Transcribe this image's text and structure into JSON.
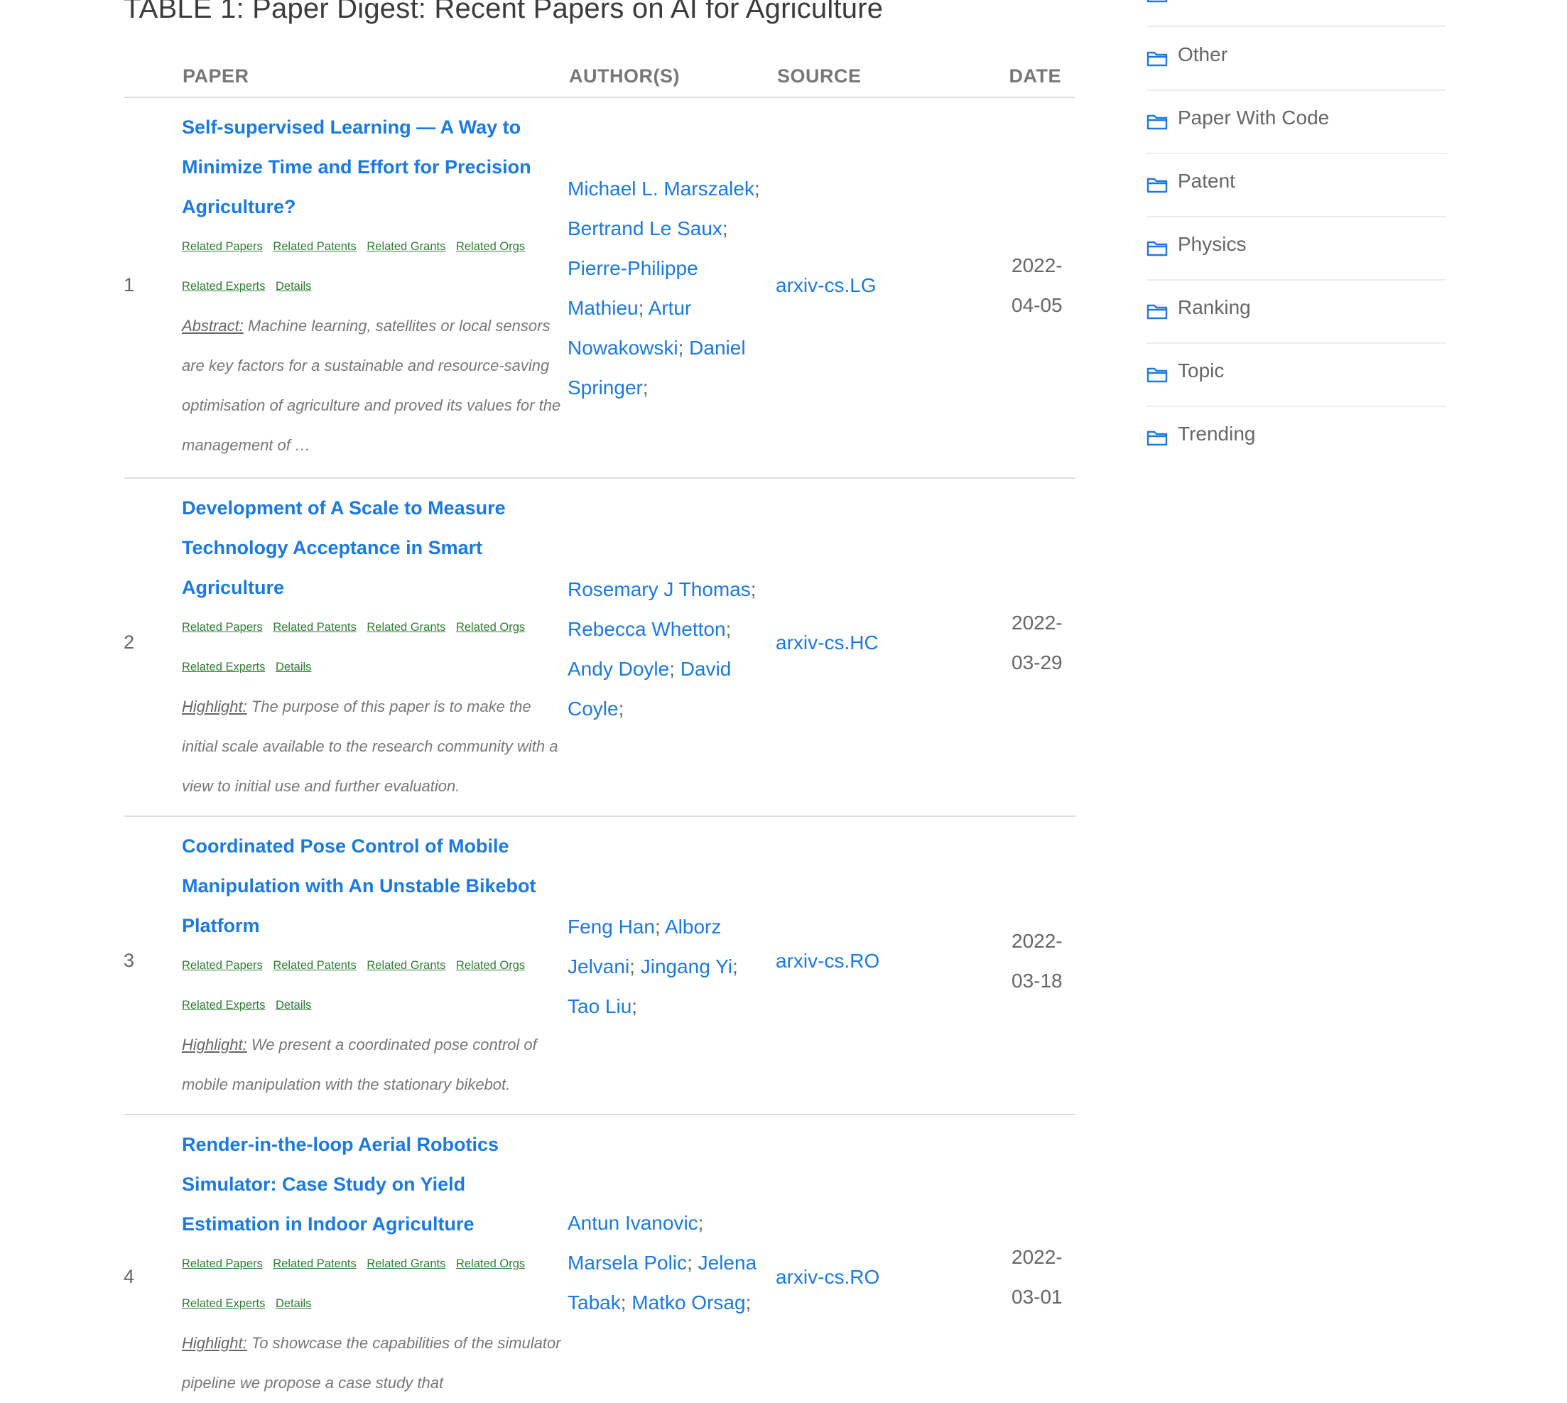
{
  "table": {
    "title": "TABLE 1: Paper Digest: Recent Papers on AI for Agriculture",
    "headers": {
      "paper": "PAPER",
      "authors": "AUTHOR(S)",
      "source": "SOURCE",
      "date": "DATE"
    },
    "link_labels": [
      "Related Papers",
      "Related Patents",
      "Related Grants",
      "Related Orgs",
      "Related Experts",
      "Details"
    ],
    "rows": [
      {
        "num": "1",
        "title": "Self-supervised Learning — A Way to Minimize Time and Effort for Precision Agriculture?",
        "summary_label": "Abstract:",
        "summary": " Machine learning, satellites or local sensors are key factors for a sustainable and resource-saving optimisation of agriculture and proved its values for the management of …",
        "authors": [
          "Michael L. Marszalek",
          "Bertrand Le Saux",
          "Pierre-Philippe Mathieu",
          "Artur Nowakowski",
          "Daniel Springer"
        ],
        "source": "arxiv-cs.LG",
        "date": "2022-04-05"
      },
      {
        "num": "2",
        "title": "Development of A Scale to Measure Technology Acceptance in Smart Agriculture",
        "summary_label": "Highlight:",
        "summary": " The purpose of this paper is to make the initial scale available to the research community with a view to initial use and further evaluation.",
        "authors": [
          "Rosemary J Thomas",
          "Rebecca Whetton",
          "Andy Doyle",
          "David Coyle"
        ],
        "source": "arxiv-cs.HC",
        "date": "2022-03-29"
      },
      {
        "num": "3",
        "title": "Coordinated Pose Control of Mobile Manipulation with An Unstable Bikebot Platform",
        "summary_label": "Highlight:",
        "summary": " We present a coordinated pose control of mobile manipulation with the stationary bikebot.",
        "authors": [
          "Feng Han",
          "Alborz Jelvani",
          "Jingang Yi",
          "Tao Liu"
        ],
        "source": "arxiv-cs.RO",
        "date": "2022-03-18"
      },
      {
        "num": "4",
        "title": "Render-in-the-loop Aerial Robotics Simulator: Case Study on Yield Estimation in Indoor Agriculture",
        "summary_label": "Highlight:",
        "summary": " To showcase the capabilities of the simulator pipeline we propose a case study that",
        "authors": [
          "Antun Ivanovic",
          "Marsela Polic",
          "Jelena Tabak",
          "Matko Orsag"
        ],
        "source": "arxiv-cs.RO",
        "date": "2022-03-01"
      }
    ]
  },
  "sidebar": {
    "categories": [
      "Other",
      "Paper With Code",
      "Patent",
      "Physics",
      "Ranking",
      "Topic",
      "Trending"
    ],
    "icon": "folder-icon",
    "accent_color": "#1a7ae0"
  }
}
